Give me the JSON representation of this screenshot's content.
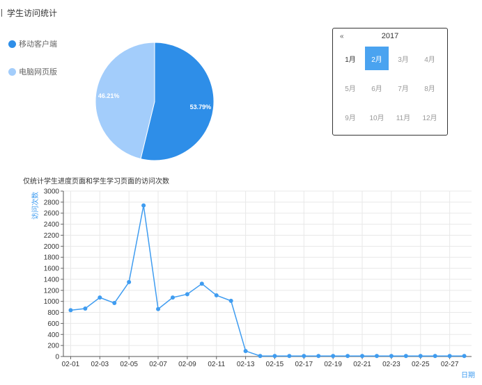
{
  "page": {
    "title": "学生访问统计"
  },
  "chart_data": [
    {
      "type": "pie",
      "slices": [
        {
          "label": "移动客户端",
          "value": 53.79,
          "display": "53.79%",
          "color": "#2e8ee8"
        },
        {
          "label": "电脑网页版",
          "value": 46.21,
          "display": "46.21%",
          "color": "#a3cdfb"
        }
      ],
      "legend_position": "left"
    },
    {
      "type": "line",
      "title": "仅统计学生进度页面和学生学习页面的访问次数",
      "ylabel": "访问次数",
      "xlabel": "日期",
      "ylim": [
        0,
        3000
      ],
      "yticks": [
        0,
        200,
        400,
        600,
        800,
        1000,
        1200,
        1400,
        1600,
        1800,
        2000,
        2200,
        2400,
        2600,
        2800,
        3000
      ],
      "x": [
        "02-01",
        "02-02",
        "02-03",
        "02-04",
        "02-05",
        "02-06",
        "02-07",
        "02-08",
        "02-09",
        "02-10",
        "02-11",
        "02-12",
        "02-13",
        "02-14",
        "02-15",
        "02-16",
        "02-17",
        "02-18",
        "02-19",
        "02-20",
        "02-21",
        "02-22",
        "02-23",
        "02-24",
        "02-25",
        "02-26",
        "02-27",
        "02-28"
      ],
      "xtick_labels": [
        "02-01",
        "02-03",
        "02-05",
        "02-07",
        "02-09",
        "02-11",
        "02-13",
        "02-15",
        "02-17",
        "02-19",
        "02-21",
        "02-23",
        "02-25",
        "02-27"
      ],
      "series": [
        {
          "values": [
            840,
            870,
            1070,
            970,
            1350,
            2740,
            860,
            1070,
            1130,
            1320,
            1110,
            1010,
            100,
            10,
            10,
            10,
            10,
            10,
            10,
            10,
            10,
            10,
            10,
            10,
            10,
            10,
            10,
            10
          ],
          "color": "#3f9cf0"
        }
      ],
      "grid": true
    }
  ],
  "calendar": {
    "prev_icon": "«",
    "year": "2017",
    "months": [
      "1月",
      "2月",
      "3月",
      "4月",
      "5月",
      "6月",
      "7月",
      "8月",
      "9月",
      "10月",
      "11月",
      "12月"
    ],
    "selected_index": 1,
    "current_index": 0
  }
}
